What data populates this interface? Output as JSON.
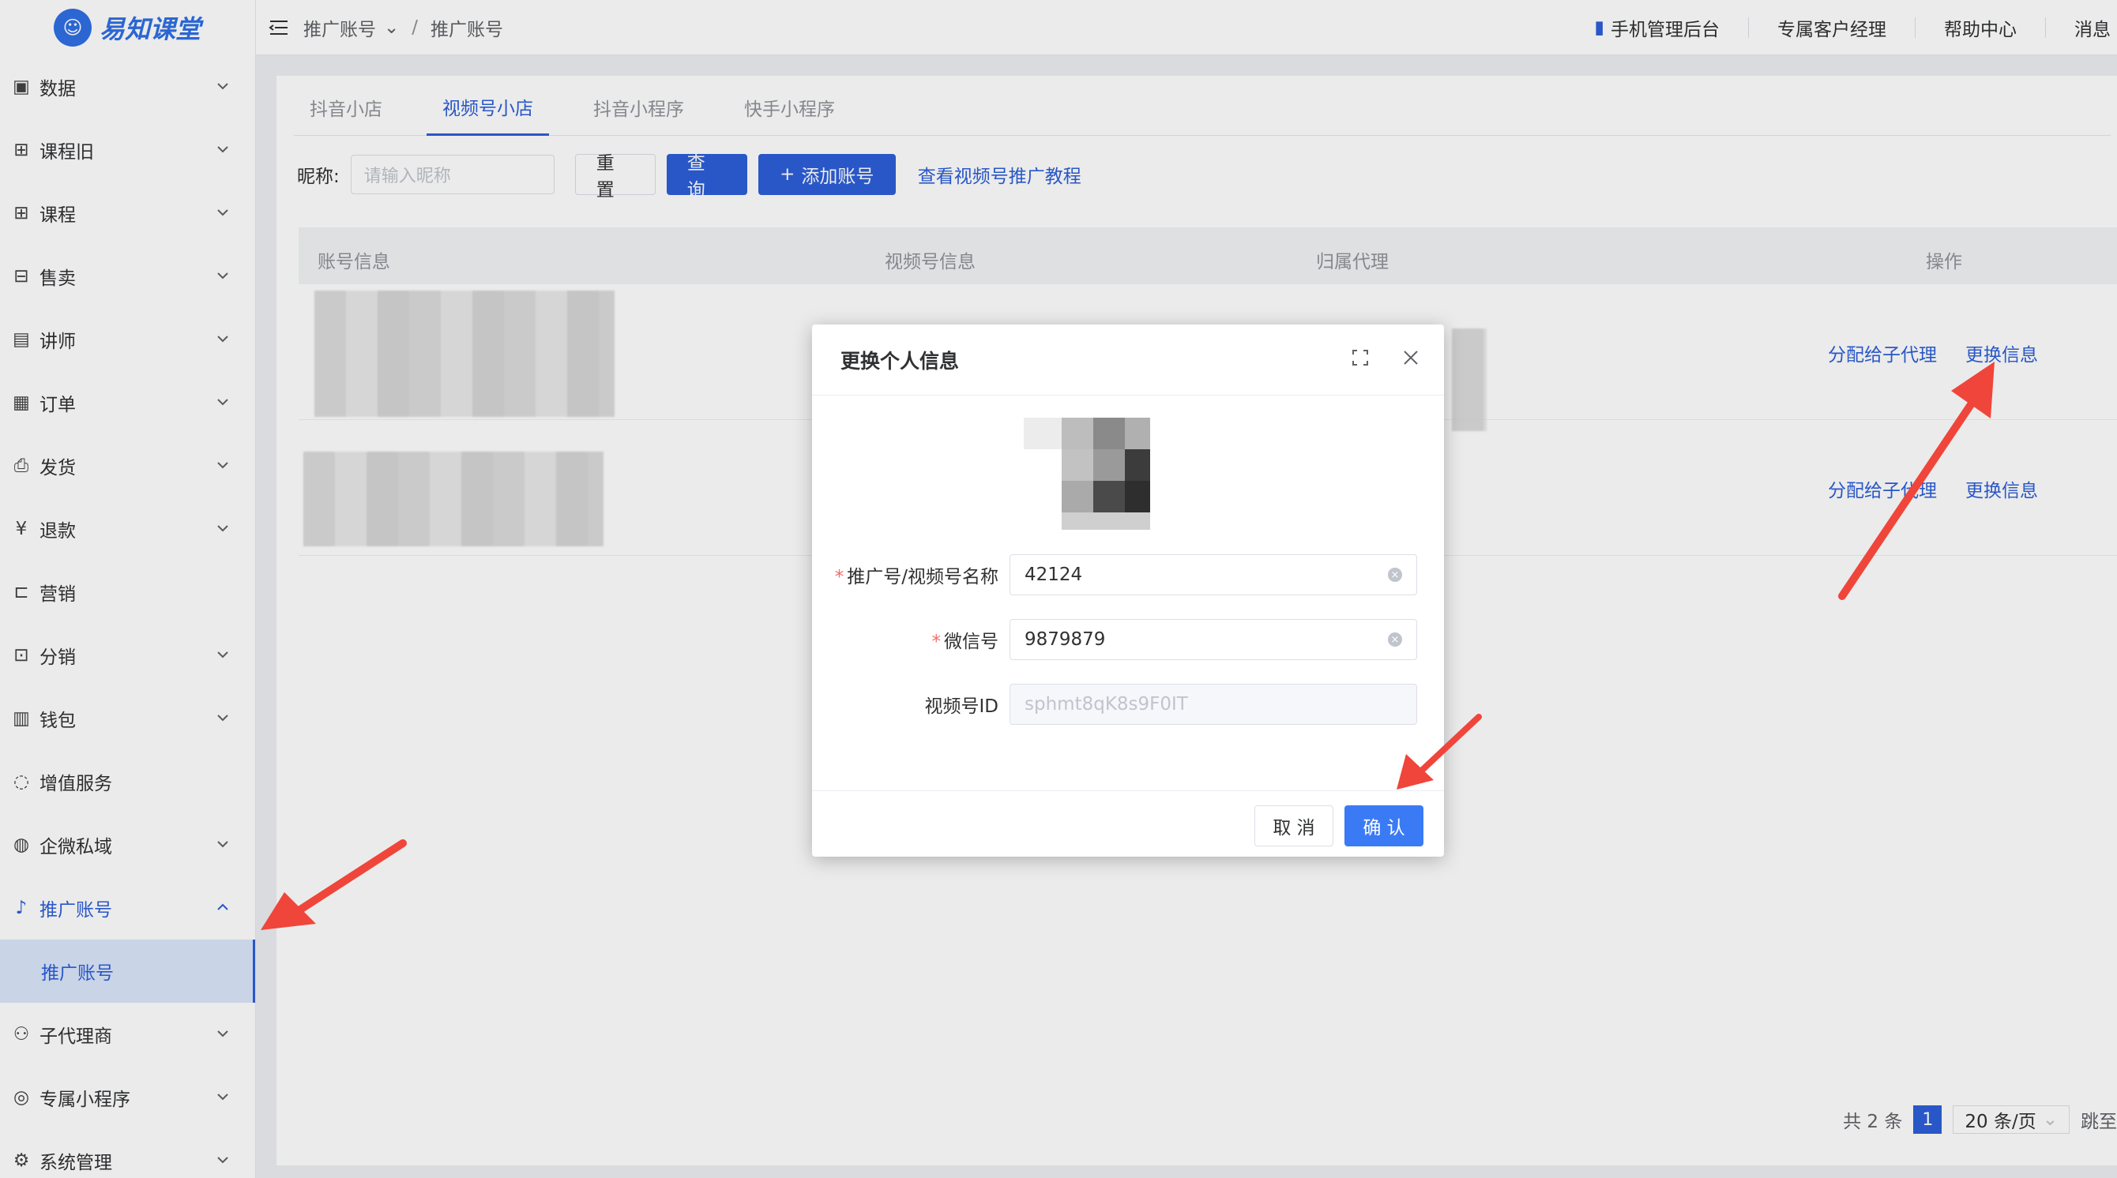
{
  "app": {
    "logo_text": "易知课堂"
  },
  "sidebar": {
    "items": [
      {
        "label": "数据",
        "icon": "chart-icon",
        "arrow": "down"
      },
      {
        "label": "课程旧",
        "icon": "grid-icon",
        "arrow": "down"
      },
      {
        "label": "课程",
        "icon": "grid-icon",
        "arrow": "down"
      },
      {
        "label": "售卖",
        "icon": "shop-icon",
        "arrow": "down"
      },
      {
        "label": "讲师",
        "icon": "teacher-icon",
        "arrow": "down"
      },
      {
        "label": "订单",
        "icon": "order-icon",
        "arrow": "down"
      },
      {
        "label": "发货",
        "icon": "printer-icon",
        "arrow": "down"
      },
      {
        "label": "退款",
        "icon": "refund-icon",
        "arrow": "down"
      },
      {
        "label": "营销",
        "icon": "bag-icon",
        "arrow": ""
      },
      {
        "label": "分销",
        "icon": "distribution-icon",
        "arrow": "down"
      },
      {
        "label": "钱包",
        "icon": "wallet-icon",
        "arrow": "down"
      },
      {
        "label": "增值服务",
        "icon": "bulb-icon",
        "arrow": ""
      },
      {
        "label": "企微私域",
        "icon": "chat-icon",
        "arrow": "down"
      },
      {
        "label": "推广账号",
        "icon": "tiktok-icon",
        "arrow": "up"
      }
    ],
    "sub_active": "推广账号",
    "items_after": [
      {
        "label": "子代理商",
        "icon": "users-icon",
        "arrow": "down"
      },
      {
        "label": "专属小程序",
        "icon": "miniapp-icon",
        "arrow": "down"
      },
      {
        "label": "系统管理",
        "icon": "gear-icon",
        "arrow": "down"
      }
    ]
  },
  "topbar": {
    "breadcrumb_1": "推广账号",
    "breadcrumb_sep": "/",
    "breadcrumb_2": "推广账号",
    "links": [
      "手机管理后台",
      "专属客户经理",
      "帮助中心",
      "消息"
    ]
  },
  "tabs": [
    "抖音小店",
    "视频号小店",
    "抖音小程序",
    "快手小程序"
  ],
  "active_tab": 1,
  "filter": {
    "label": "昵称:",
    "placeholder": "请输入昵称",
    "reset": "重 置",
    "query": "查 询",
    "add": "添加账号",
    "tutorial": "查看视频号推广教程"
  },
  "table": {
    "headers": [
      "账号信息",
      "视频号信息",
      "归属代理",
      "操作"
    ],
    "rows": [
      {
        "action_1": "分配给子代理",
        "action_2": "更换信息"
      },
      {
        "action_1": "分配给子代理",
        "action_2": "更换信息"
      }
    ]
  },
  "pager": {
    "total": "共 2 条",
    "page": "1",
    "size": "20 条/页",
    "jump": "跳至"
  },
  "dialog": {
    "title": "更换个人信息",
    "fields": [
      {
        "label": "推广号/视频号名称",
        "value": "42124",
        "required": true
      },
      {
        "label": "微信号",
        "value": "9879879",
        "required": true
      },
      {
        "label": "视频号ID",
        "value": "sphmt8qK8s9F0IT",
        "required": false
      }
    ],
    "cancel": "取 消",
    "ok": "确 认"
  },
  "colors": {
    "primary": "#2d5fd8",
    "arrow": "#f0453a"
  }
}
